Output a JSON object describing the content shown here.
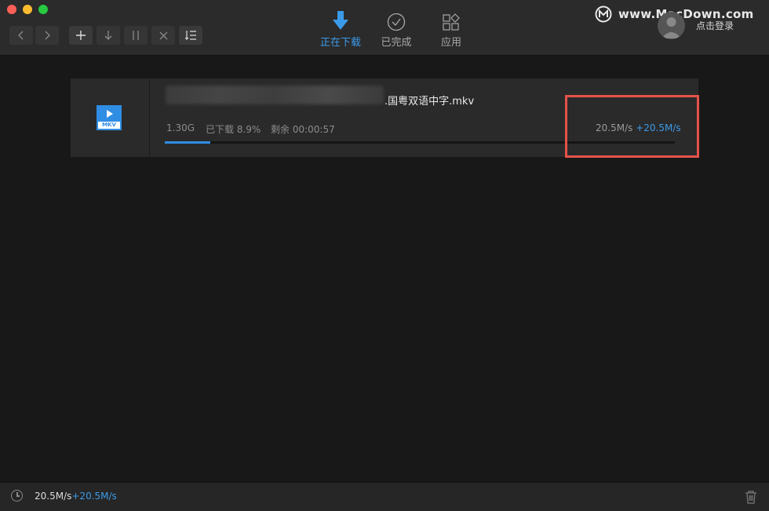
{
  "header": {
    "tabs": [
      {
        "label": "正在下载",
        "icon": "download-arrow-icon",
        "selected": true
      },
      {
        "label": "已完成",
        "icon": "checkmark-circle-icon",
        "selected": false
      },
      {
        "label": "应用",
        "icon": "apps-grid-icon",
        "selected": false
      }
    ],
    "brand": "www.MacDown.com",
    "login_label": "点击登录"
  },
  "download": {
    "filename_suffix": ".国粤双语中字.mkv",
    "file_type": "MKV",
    "size": "1.30G",
    "downloaded": "已下载 8.9%",
    "remaining": "剩余 00:00:57",
    "progress_pct": 8.9,
    "speed": "20.5M/s",
    "boost_speed": "+20.5M/s"
  },
  "status": {
    "speed": "20.5M/s",
    "boost_speed": "+20.5M/s"
  },
  "colors": {
    "accent": "#3a9ae8",
    "highlight_box": "#e5524a"
  }
}
